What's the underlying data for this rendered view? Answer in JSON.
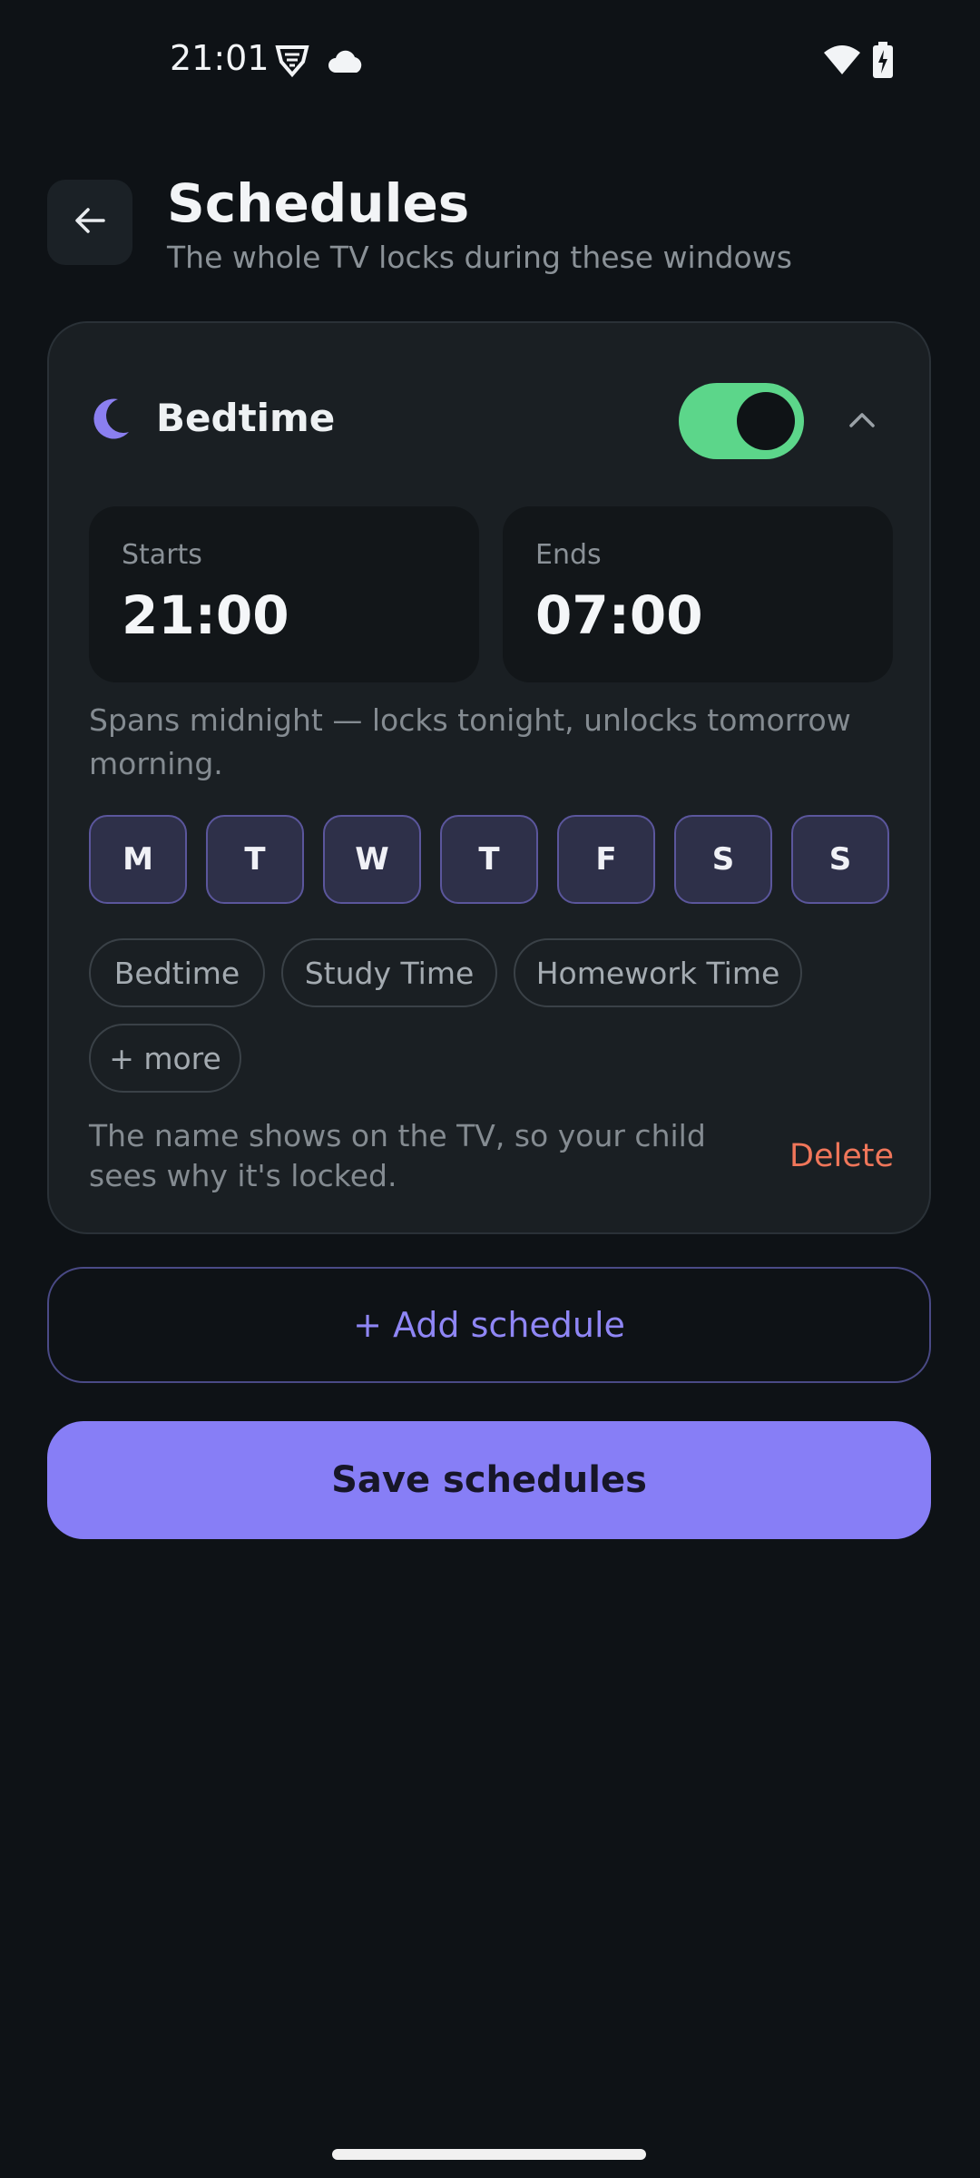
{
  "status_bar": {
    "time": "21:01",
    "icons": [
      "vpn-shield-icon",
      "cloud-icon",
      "wifi-icon",
      "battery-charging-icon"
    ]
  },
  "header": {
    "back_icon": "arrow-left-icon",
    "title": "Schedules",
    "subtitle": "The whole TV locks during these windows"
  },
  "schedule": {
    "icon": "moon-icon",
    "name": "Bedtime",
    "enabled": true,
    "collapse_icon": "chevron-up-icon",
    "starts_label": "Starts",
    "starts_value": "21:00",
    "ends_label": "Ends",
    "ends_value": "07:00",
    "span_note": "Spans midnight — locks tonight, unlocks tomorrow morning.",
    "days": [
      "M",
      "T",
      "W",
      "T",
      "F",
      "S",
      "S"
    ],
    "name_suggestions": [
      "Bedtime",
      "Study Time",
      "Homework Time",
      "+ more"
    ],
    "help_text": "The name shows on the TV, so your child sees why it's locked.",
    "delete_label": "Delete"
  },
  "actions": {
    "add_label": "+ Add schedule",
    "save_label": "Save schedules"
  },
  "colors": {
    "background": "#0e1216",
    "card": "#1a1f23",
    "accent": "#877ef6",
    "toggle_on": "#5cd68a",
    "danger": "#f0765a"
  }
}
